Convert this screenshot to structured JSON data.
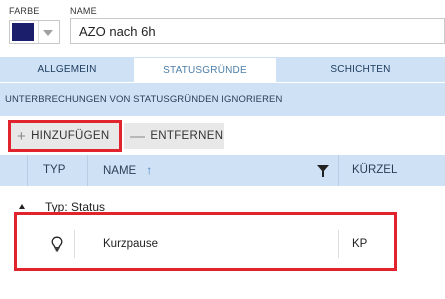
{
  "form": {
    "color_label": "FARBE",
    "color_value": "#1b1f6b",
    "name_label": "NAME",
    "name_value": "AZO nach 6h"
  },
  "tabs": [
    {
      "label": "ALLGEMEIN",
      "active": false
    },
    {
      "label": "STATUSGRÜNDE",
      "active": true
    },
    {
      "label": "SCHICHTEN",
      "active": false
    }
  ],
  "ignore_bar": {
    "label": "UNTERBRECHUNGEN VON STATUSGRÜNDEN IGNORIEREN"
  },
  "toolbar": {
    "add_icon": "plus-icon",
    "add_label": "HINZUFÜGEN",
    "remove_icon": "minus-icon",
    "remove_label": "ENTFERNEN"
  },
  "grid": {
    "columns": {
      "typ": "TYP",
      "name": "NAME",
      "name_sort": "ascending",
      "kuerzel": "KÜRZEL"
    },
    "groups": [
      {
        "label": "Typ: Status",
        "expanded": true,
        "rows": [
          {
            "icon": "lightbulb-icon",
            "name": "Kurzpause",
            "kuerzel": "KP"
          }
        ]
      }
    ]
  },
  "colors": {
    "accent_blue": "#cfe1f5",
    "active_tab_text": "#4d7ea8",
    "highlight_red": "#e0232d"
  }
}
